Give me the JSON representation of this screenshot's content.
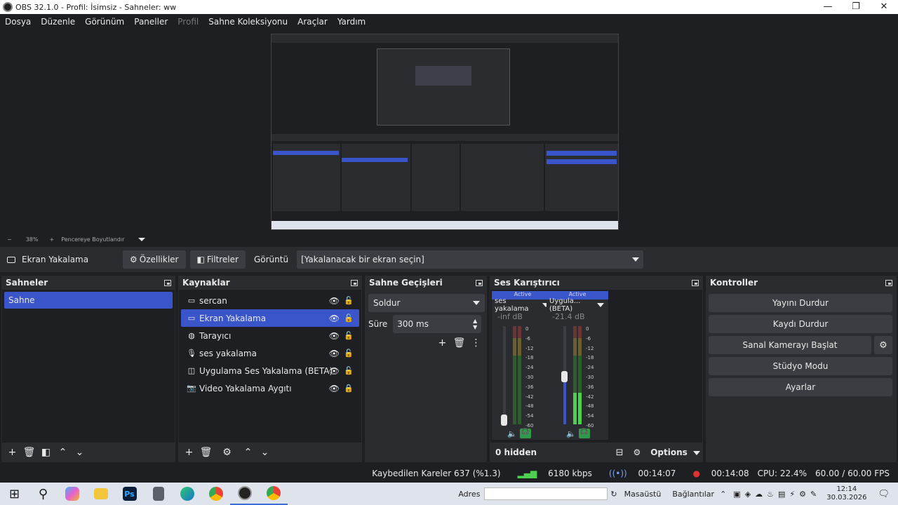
{
  "window": {
    "title": "OBS 32.1.0 - Profil: İsimsiz - Sahneler: ww",
    "minimize": "—",
    "maximize": "❐",
    "close": "✕"
  },
  "menu": [
    "Dosya",
    "Düzenle",
    "Görünüm",
    "Paneller",
    "Profil",
    "Sahne Koleksiyonu",
    "Araçlar",
    "Yardım"
  ],
  "zoom": {
    "minus": "−",
    "value": "38%",
    "plus": "+",
    "fit": "Pencereye Boyutlandır"
  },
  "sourcebar": {
    "source_name": "Ekran Yakalama",
    "properties": "Özellikler",
    "filters": "Filtreler",
    "display_label": "Görüntü",
    "display_value": "[Yakalanacak bir ekran seçin]"
  },
  "scenes": {
    "title": "Sahneler",
    "items": [
      "Sahne"
    ]
  },
  "sources": {
    "title": "Kaynaklar",
    "items": [
      {
        "name": "sercan",
        "icon": "monitor-icon",
        "locked": false
      },
      {
        "name": "Ekran Yakalama",
        "icon": "monitor-icon",
        "locked": false
      },
      {
        "name": "Tarayıcı",
        "icon": "globe-icon",
        "locked": false
      },
      {
        "name": "ses yakalama",
        "icon": "microphone-icon",
        "locked": false
      },
      {
        "name": "Uygulama Ses Yakalama (BETA)",
        "icon": "app-audio-icon",
        "locked": false
      },
      {
        "name": "Video Yakalama Aygıtı",
        "icon": "camera-icon",
        "locked": true
      }
    ]
  },
  "transitions": {
    "title": "Sahne Geçişleri",
    "selected": "Soldur",
    "duration_label": "Süre",
    "duration_value": "300 ms"
  },
  "mixer": {
    "title": "Ses Karıştırıcı",
    "channels": [
      {
        "status": "Active",
        "name": "ses yakalama",
        "db": "-inf dB"
      },
      {
        "status": "Active",
        "name": "Uygula...(BETA)",
        "db": "-21.4 dB"
      }
    ],
    "scale": [
      "0",
      "-6",
      "-12",
      "-18",
      "-24",
      "-30",
      "-36",
      "-42",
      "-48",
      "-54",
      "-60"
    ],
    "hidden": "0 hidden",
    "options": "Options"
  },
  "controls": {
    "title": "Kontroller",
    "stop_stream": "Yayını Durdur",
    "stop_record": "Kaydı Durdur",
    "virtual_cam": "Sanal Kamerayı Başlat",
    "studio_mode": "Stüdyo Modu",
    "settings": "Ayarlar"
  },
  "status": {
    "dropped": "Kaybedilen Kareler 637 (%1.3)",
    "bitrate": "6180 kbps",
    "stream_time": "00:14:07",
    "rec_time": "00:14:08",
    "cpu": "CPU: 22.4%",
    "fps": "60.00 / 60.00 FPS"
  },
  "taskbar": {
    "address_label": "Adres",
    "desktop": "Masaüstü",
    "links": "Bağlantılar",
    "time": "12:14",
    "date": "30.03.2026"
  },
  "colors": {
    "accent": "#3a55c9",
    "bg": "#1e1f22",
    "panel": "#2b2c30",
    "button": "#3c3d42"
  }
}
